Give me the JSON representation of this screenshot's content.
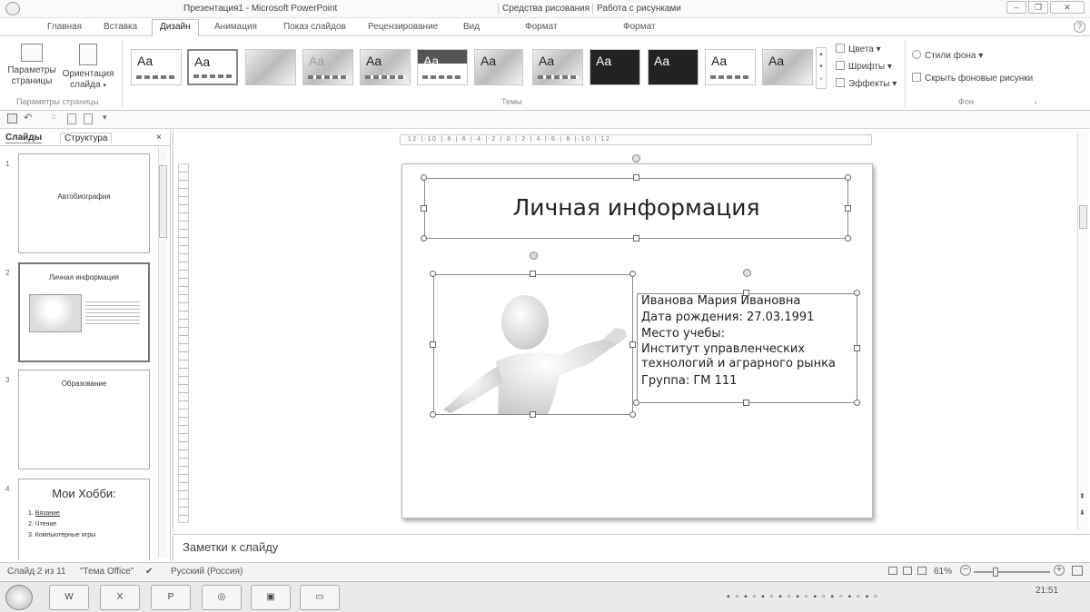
{
  "window": {
    "title": "Презентация1 - Microsoft PowerPoint",
    "context_tabs": [
      "Средства рисования",
      "Работа с рисунками"
    ]
  },
  "tabs": [
    "Главная",
    "Вставка",
    "Дизайн",
    "Анимация",
    "Показ слайдов",
    "Рецензирование",
    "Вид",
    "Формат",
    "Формат"
  ],
  "ribbon": {
    "page_setup": {
      "btn1_line1": "Параметры",
      "btn1_line2": "страницы",
      "btn2_line1": "Ориентация",
      "btn2_line2": "слайда",
      "group": "Параметры страницы"
    },
    "themes": {
      "group": "Темы",
      "sample": "Aa"
    },
    "theme_options": {
      "colors": "Цвета",
      "fonts": "Шрифты",
      "effects": "Эффекты"
    },
    "background": {
      "styles": "Стили фона",
      "hide": "Скрыть фоновые рисунки",
      "group": "Фон"
    }
  },
  "panel": {
    "tab_slides": "Слайды",
    "tab_outline": "Структура",
    "close": "×"
  },
  "thumbs": [
    {
      "num": "1",
      "title": "Автобиография"
    },
    {
      "num": "2",
      "title": "Личная информация"
    },
    {
      "num": "3",
      "title": "Образование"
    },
    {
      "num": "4",
      "title": "Мои Хобби:",
      "items": [
        "Вязание",
        "Чтение",
        "Компьютерные игры"
      ]
    }
  ],
  "ruler": "·12·|·10·|·8·|·6·|·4·|·2·|·0·|·2·|·4·|·6·|·8·|·10·|·12·",
  "slide": {
    "title": "Личная информация",
    "lines": [
      "Иванова Мария Ивановна",
      "Дата рождения: 27.03.1991",
      "Место учебы:",
      "Институт управленческих",
      "технологий и аграрного рынка",
      "Группа: ГМ 111"
    ]
  },
  "notes_placeholder": "Заметки к слайду",
  "status": {
    "slide": "Слайд 2 из 11",
    "theme": "\"Тема Office\"",
    "lang": "Русский (Россия)",
    "zoom": "61%",
    "zoom_fraction": 0.61
  },
  "taskbar": {
    "time": "21:51"
  }
}
